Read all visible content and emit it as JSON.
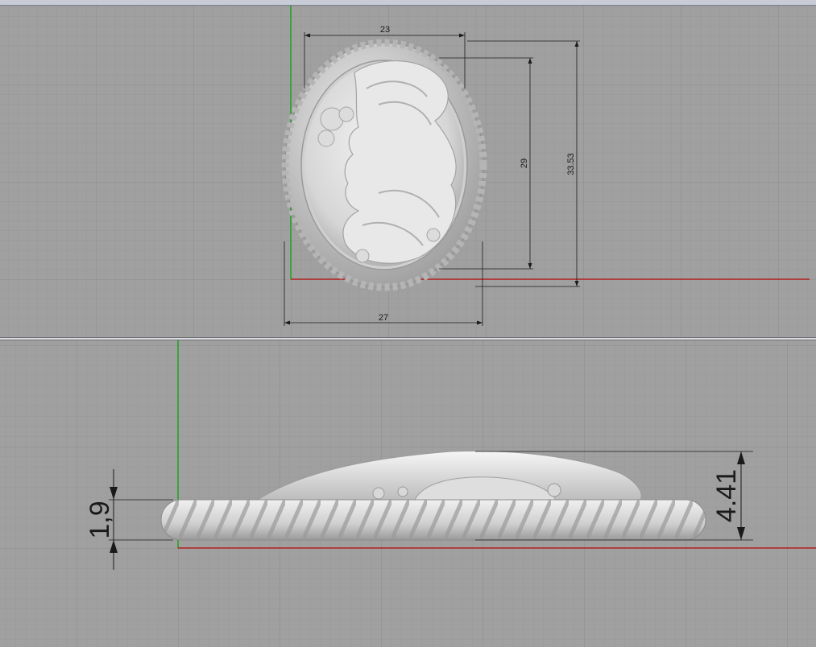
{
  "viewports": {
    "top": {
      "dimensions": {
        "width_inner": "23",
        "width_outer": "27",
        "height_inner": "29",
        "height_outer": "33.53"
      }
    },
    "bottom": {
      "dimensions": {
        "base_thickness": "1,9",
        "total_height": "4.41"
      }
    }
  },
  "colors": {
    "background": "#a0a0a0",
    "grid_minor": "#969696",
    "grid_major": "#8a8a8a",
    "x_axis": "#b32020",
    "y_axis": "#1fa01f",
    "model": "#d9d9d9",
    "dimension_line": "#1a1a1a"
  }
}
